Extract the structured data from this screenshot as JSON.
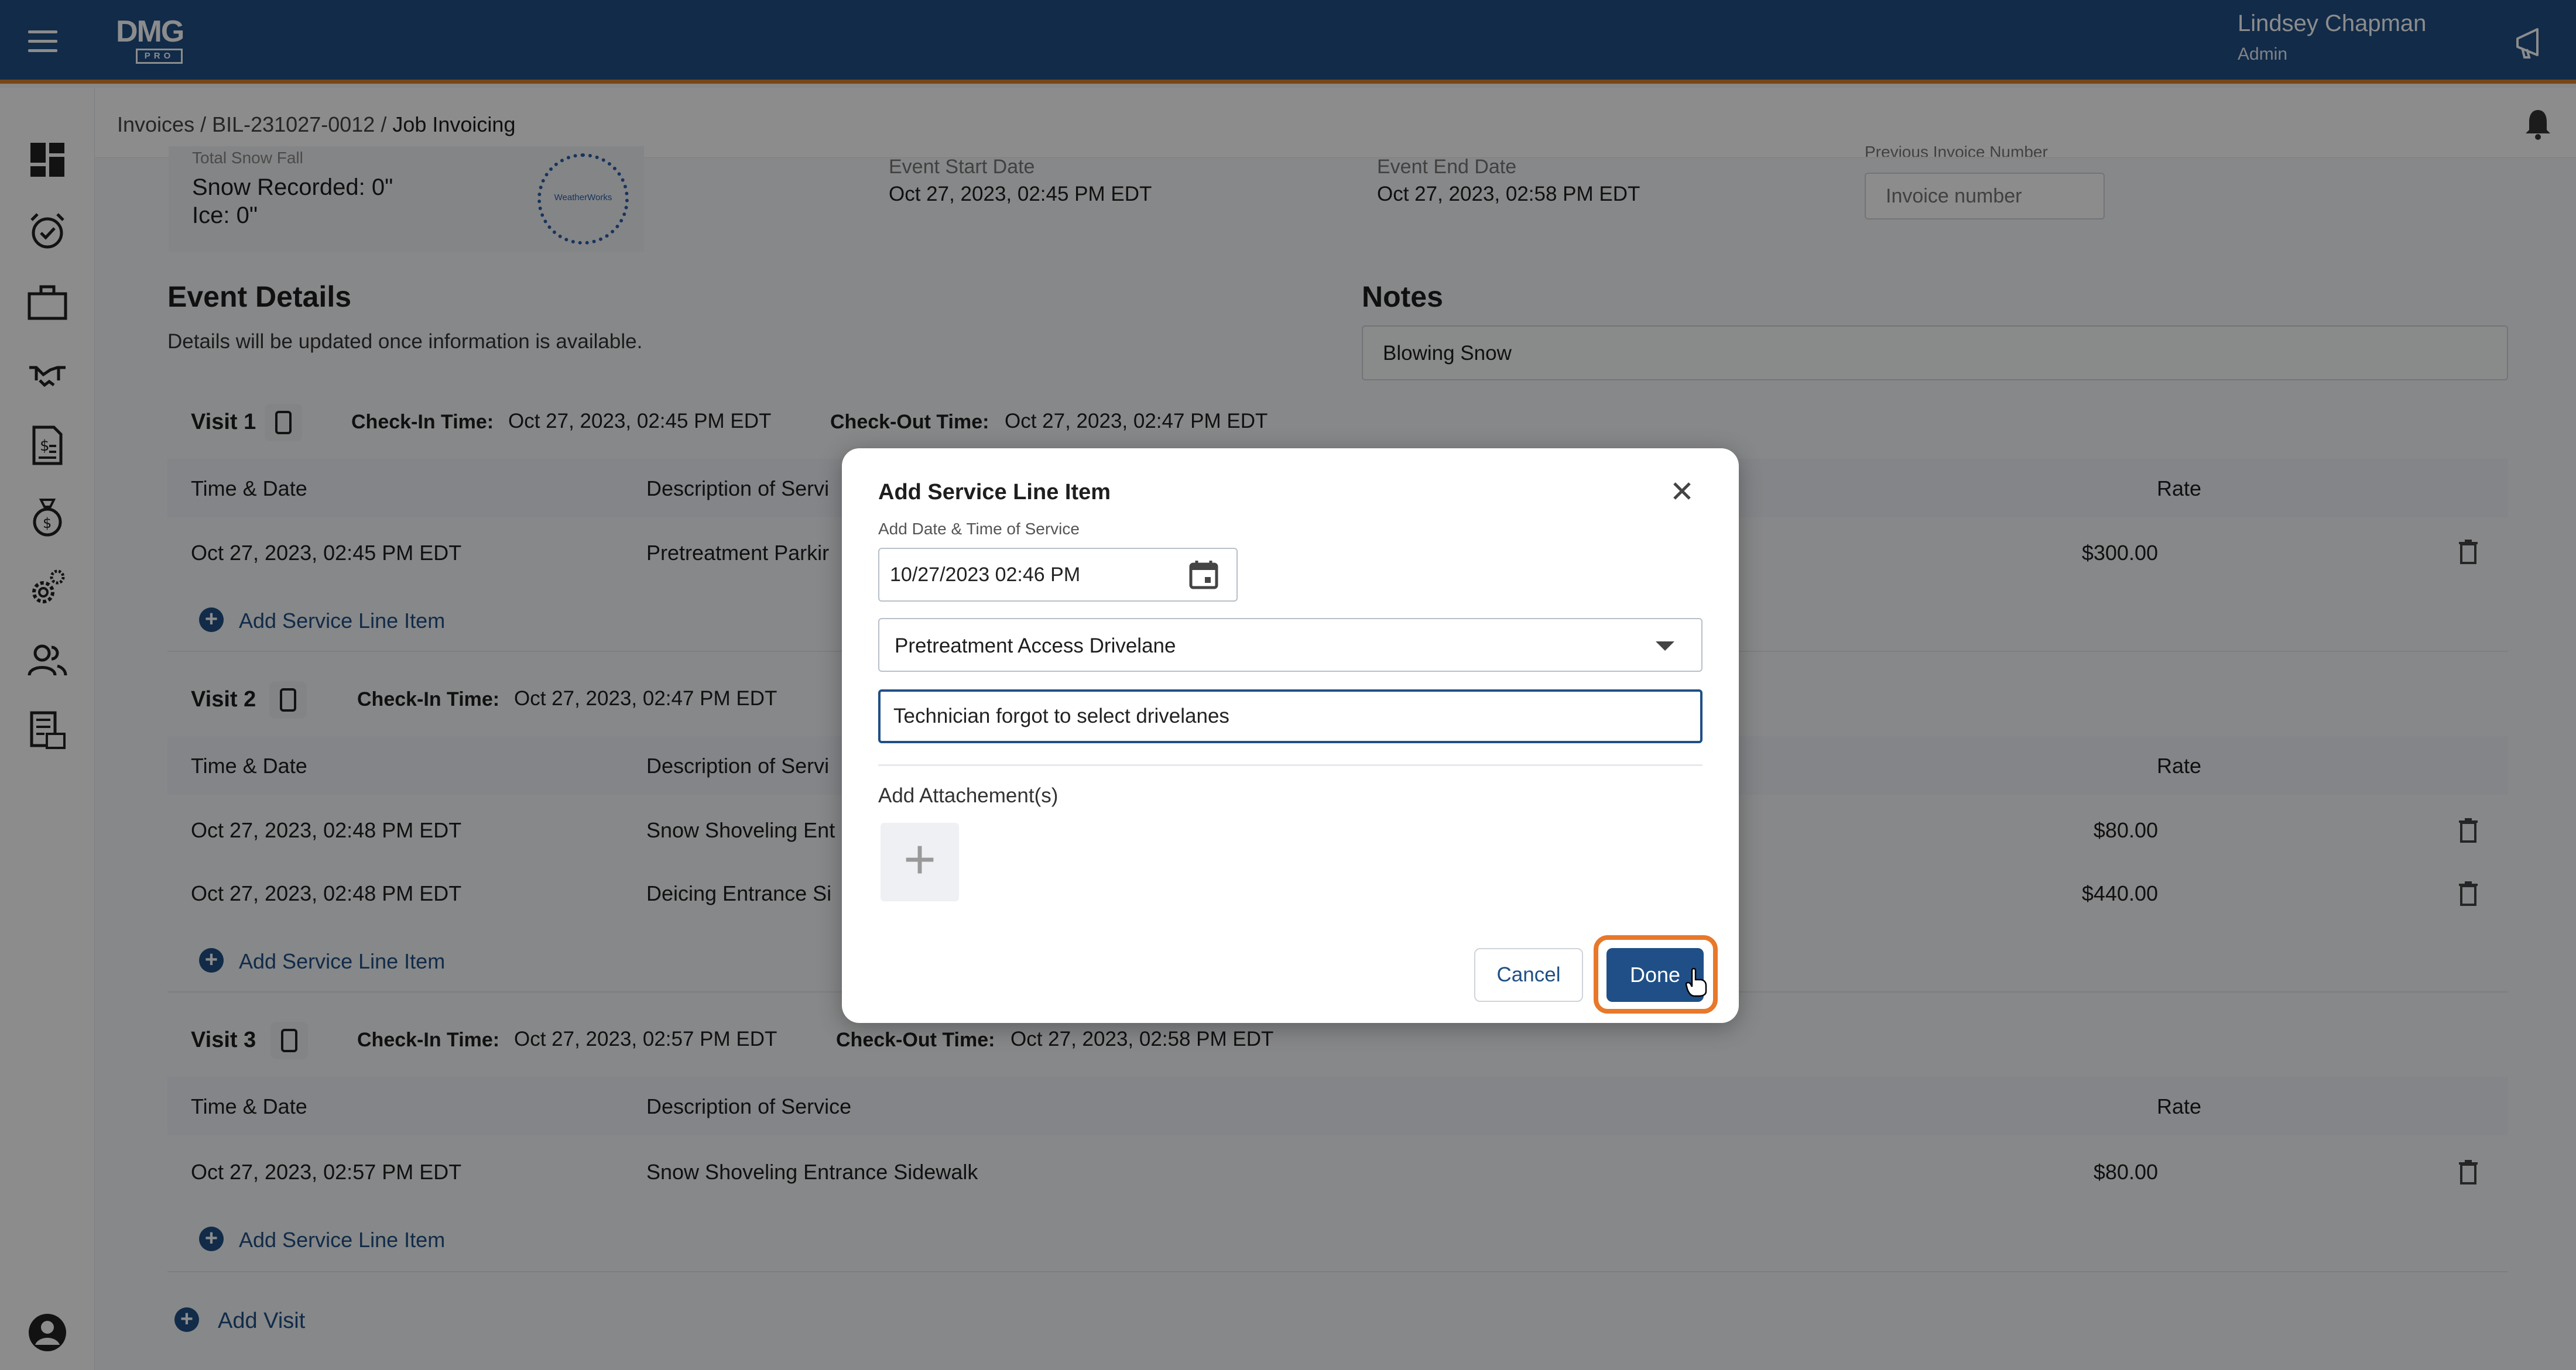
{
  "topbar": {
    "logo_text": "DMG",
    "logo_sub": "PRO",
    "user_name": "Lindsey Chapman",
    "user_role": "Admin",
    "colors": {
      "bar": "#1f4f86",
      "accent_line": "#d9822b"
    }
  },
  "sidebar": {
    "icons": [
      "dashboard-icon",
      "alarm-check-icon",
      "briefcase-icon",
      "handshake-icon",
      "invoice-icon",
      "money-bag-icon",
      "gears-icon",
      "users-icon",
      "report-icon",
      "account-icon"
    ]
  },
  "breadcrumb": {
    "part1": "Invoices",
    "sep": " / ",
    "part2": "BIL-231027-0012",
    "current": "Job Invoicing"
  },
  "event": {
    "snow_label": "Total Snow Fall",
    "snow_recorded": "Snow Recorded: 0\"",
    "ice": "Ice: 0\"",
    "seal_text": "WeatherWorks",
    "start_label": "Event Start Date",
    "start_value": "Oct 27, 2023, 02:45 PM EDT",
    "end_label": "Event End Date",
    "end_value": "Oct 27, 2023, 02:58 PM EDT",
    "invoice_label": "Previous Invoice Number",
    "invoice_placeholder": "Invoice number"
  },
  "details": {
    "title": "Event Details",
    "subtext": "Details will be updated once information is available.",
    "notes_title": "Notes",
    "notes_value": "Blowing Snow"
  },
  "table_headers": {
    "time": "Time & Date",
    "desc": "Description of Service",
    "desc_cut": "Description of Servi",
    "rate": "Rate"
  },
  "add_line_label": "Add Service Line Item",
  "add_visit_label": "Add Visit",
  "visits": [
    {
      "title": "Visit 1",
      "checkin_label": "Check-In Time:",
      "checkin_value": "Oct 27, 2023, 02:45 PM EDT",
      "checkout_label": "Check-Out Time:",
      "checkout_value": "Oct 27, 2023, 02:47 PM EDT",
      "rows": [
        {
          "time": "Oct 27, 2023, 02:45 PM EDT",
          "desc": "Pretreatment Parkir",
          "rate": "$300.00"
        }
      ]
    },
    {
      "title": "Visit 2",
      "checkin_label": "Check-In Time:",
      "checkin_value": "Oct 27, 2023, 02:47 PM EDT",
      "rows": [
        {
          "time": "Oct 27, 2023, 02:48 PM EDT",
          "desc": "Snow Shoveling Ent",
          "rate": "$80.00"
        },
        {
          "time": "Oct 27, 2023, 02:48 PM EDT",
          "desc": "Deicing Entrance Si",
          "rate": "$440.00"
        }
      ]
    },
    {
      "title": "Visit 3",
      "checkin_label": "Check-In Time:",
      "checkin_value": "Oct 27, 2023, 02:57 PM EDT",
      "checkout_label": "Check-Out Time:",
      "checkout_value": "Oct 27, 2023, 02:58 PM EDT",
      "rows": [
        {
          "time": "Oct 27, 2023, 02:57 PM EDT",
          "desc": "Snow Shoveling Entrance Sidewalk",
          "rate": "$80.00"
        }
      ]
    }
  ],
  "dialog": {
    "title": "Add Service Line Item",
    "date_label": "Add Date & Time of Service",
    "date_value": "10/27/2023 02:46 PM",
    "service_value": "Pretreatment Access Drivelane",
    "description_value": "Technician forgot to select drivelanes",
    "attach_label": "Add Attachement(s)",
    "cancel_label": "Cancel",
    "done_label": "Done",
    "highlight_color": "#e8782a"
  }
}
